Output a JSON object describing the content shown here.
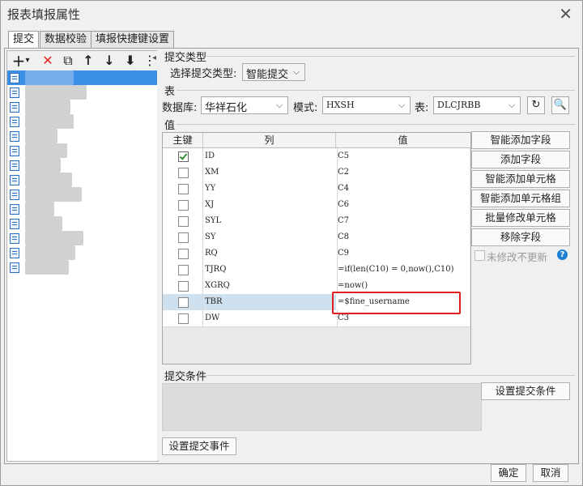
{
  "window": {
    "title": "报表填报属性"
  },
  "tabs": [
    "提交",
    "数据校验",
    "填报快捷键设置"
  ],
  "toolbar": {
    "add": "+",
    "dropdown": "▾",
    "delete": "✕",
    "copy": "⧉",
    "up": "↑",
    "down": "↓",
    "bottom": "⬇",
    "more": "⋮"
  },
  "commit_type": {
    "section": "提交类型",
    "label": "选择提交类型:",
    "value": "智能提交"
  },
  "table_section": {
    "section": "表",
    "db_label": "数据库:",
    "db_value": "华祥石化",
    "mode_label": "模式:",
    "mode_value": "HXSH",
    "table_label": "表:",
    "table_value": "DLCJRBB"
  },
  "value_section": {
    "section": "值",
    "columns": [
      "主键",
      "列",
      "值"
    ],
    "rows": [
      {
        "key": true,
        "col": "ID",
        "val": "C5"
      },
      {
        "key": false,
        "col": "XM",
        "val": "C2"
      },
      {
        "key": false,
        "col": "YY",
        "val": "C4"
      },
      {
        "key": false,
        "col": "XJ",
        "val": "C6"
      },
      {
        "key": false,
        "col": "SYL",
        "val": "C7"
      },
      {
        "key": false,
        "col": "SY",
        "val": "C8"
      },
      {
        "key": false,
        "col": "RQ",
        "val": "C9"
      },
      {
        "key": false,
        "col": "TJRQ",
        "val": "=if(len(C10) = 0,now(),C10)"
      },
      {
        "key": false,
        "col": "XGRQ",
        "val": "=now()"
      },
      {
        "key": false,
        "col": "TBR",
        "val": "=$fine_username"
      },
      {
        "key": false,
        "col": "DW",
        "val": "C3"
      }
    ]
  },
  "side_buttons": [
    "智能添加字段",
    "添加字段",
    "智能添加单元格",
    "智能添加单元格组",
    "批量修改单元格",
    "移除字段"
  ],
  "no_update_label": "未修改不更新",
  "help_icon": "?",
  "commit_condition": {
    "section": "提交条件",
    "button": "设置提交条件"
  },
  "commit_event_button": "设置提交事件",
  "ok_button": "确定",
  "cancel_button": "取消",
  "colors": {
    "selection": "#3b8fe5",
    "highlight": "#e02020"
  }
}
